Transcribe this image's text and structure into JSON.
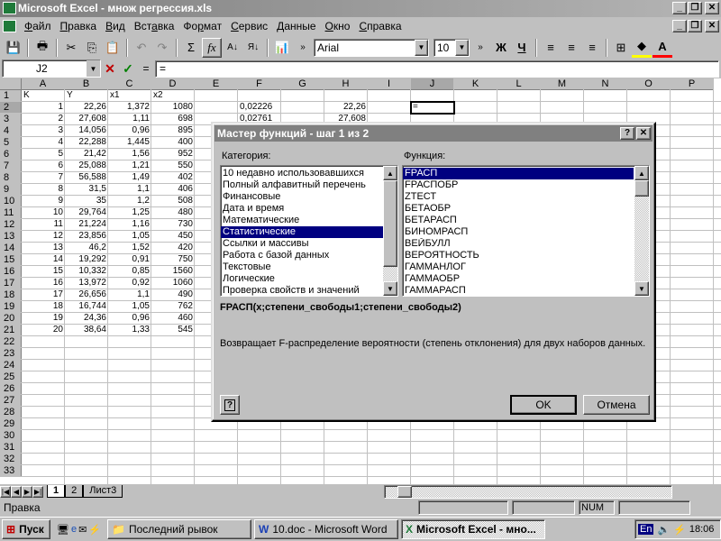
{
  "window": {
    "title": "Microsoft Excel - множ регрессия.xls"
  },
  "menu": [
    {
      "pre": "",
      "u": "Ф",
      "post": "айл"
    },
    {
      "pre": "",
      "u": "П",
      "post": "равка"
    },
    {
      "pre": "",
      "u": "В",
      "post": "ид"
    },
    {
      "pre": "Вст",
      "u": "а",
      "post": "вка"
    },
    {
      "pre": "Фо",
      "u": "р",
      "post": "мат"
    },
    {
      "pre": "",
      "u": "С",
      "post": "ервис"
    },
    {
      "pre": "",
      "u": "Д",
      "post": "анные"
    },
    {
      "pre": "",
      "u": "О",
      "post": "кно"
    },
    {
      "pre": "",
      "u": "С",
      "post": "правка"
    }
  ],
  "toolbar": {
    "font": "Arial",
    "size": "10",
    "bold": "Ж",
    "underline": "Ч",
    "sum": "Σ",
    "fx": "fx"
  },
  "formula": {
    "namebox": "J2",
    "value": "=",
    "cancel": "✕",
    "enter": "✓",
    "equals": "="
  },
  "columns": [
    "A",
    "B",
    "C",
    "D",
    "E",
    "F",
    "G",
    "H",
    "I",
    "J",
    "K",
    "L",
    "M",
    "N",
    "O",
    "P"
  ],
  "rows": [
    "1",
    "2",
    "3",
    "4",
    "5",
    "6",
    "7",
    "8",
    "9",
    "10",
    "11",
    "12",
    "13",
    "14",
    "15",
    "16",
    "17",
    "18",
    "19",
    "20",
    "21",
    "22",
    "23",
    "24",
    "25",
    "26",
    "27",
    "28",
    "29",
    "30",
    "31",
    "32",
    "33"
  ],
  "cells": {
    "headers": [
      "K",
      "Y",
      "x1",
      "x2"
    ],
    "data": [
      [
        "1",
        "22,26",
        "1,372",
        "1080"
      ],
      [
        "2",
        "27,608",
        "1,11",
        "698"
      ],
      [
        "3",
        "14,056",
        "0,96",
        "895"
      ],
      [
        "4",
        "22,288",
        "1,445",
        "400"
      ],
      [
        "5",
        "21,42",
        "1,56",
        "952"
      ],
      [
        "6",
        "25,088",
        "1,21",
        "550"
      ],
      [
        "7",
        "56,588",
        "1,49",
        "402"
      ],
      [
        "8",
        "31,5",
        "1,1",
        "406"
      ],
      [
        "9",
        "35",
        "1,2",
        "508"
      ],
      [
        "10",
        "29,764",
        "1,25",
        "480"
      ],
      [
        "11",
        "21,224",
        "1,16",
        "730"
      ],
      [
        "12",
        "23,856",
        "1,05",
        "450"
      ],
      [
        "13",
        "46,2",
        "1,52",
        "420"
      ],
      [
        "14",
        "19,292",
        "0,91",
        "750"
      ],
      [
        "15",
        "10,332",
        "0,85",
        "1560"
      ],
      [
        "16",
        "13,972",
        "0,92",
        "1060"
      ],
      [
        "17",
        "26,656",
        "1,1",
        "490"
      ],
      [
        "18",
        "16,744",
        "1,05",
        "762"
      ],
      [
        "19",
        "24,36",
        "0,96",
        "460"
      ],
      [
        "20",
        "38,64",
        "1,33",
        "545"
      ]
    ],
    "F2": "0,02226",
    "F3": "0,02761",
    "H2": "22,26",
    "H3": "27,608",
    "J2": "="
  },
  "sheet_tabs": [
    "1",
    "2",
    "Лист3"
  ],
  "status": {
    "text": "Правка",
    "num": "NUM"
  },
  "dialog": {
    "title": "Мастер функций - шаг 1 из 2",
    "category_label": "Категория:",
    "function_label": "Функция:",
    "categories": [
      "10 недавно использовавшихся",
      "Полный алфавитный перечень",
      "Финансовые",
      "Дата и время",
      "Математические",
      "Статистические",
      "Ссылки и массивы",
      "Работа с базой данных",
      "Текстовые",
      "Логические",
      "Проверка свойств и значений"
    ],
    "selected_category": "Статистические",
    "functions": [
      "FРАСП",
      "FРАСПОБР",
      "ZТЕСТ",
      "БЕТАОБР",
      "БЕТАРАСП",
      "БИНОМРАСП",
      "ВЕЙБУЛЛ",
      "ВЕРОЯТНОСТЬ",
      "ГАММАНЛОГ",
      "ГАММАОБР",
      "ГАММАРАСП"
    ],
    "selected_function": "FРАСП",
    "syntax": "FРАСП(x;степени_свободы1;степени_свободы2)",
    "description": "Возвращает F-распределение вероятности (степень отклонения) для двух наборов данных.",
    "ok": "OK",
    "cancel": "Отмена",
    "help": "?"
  },
  "taskbar": {
    "start": "Пуск",
    "items": [
      "Последний рывок",
      "10.doc - Microsoft Word",
      "Microsoft Excel - мно..."
    ],
    "lang": "En",
    "clock": "18:06"
  }
}
